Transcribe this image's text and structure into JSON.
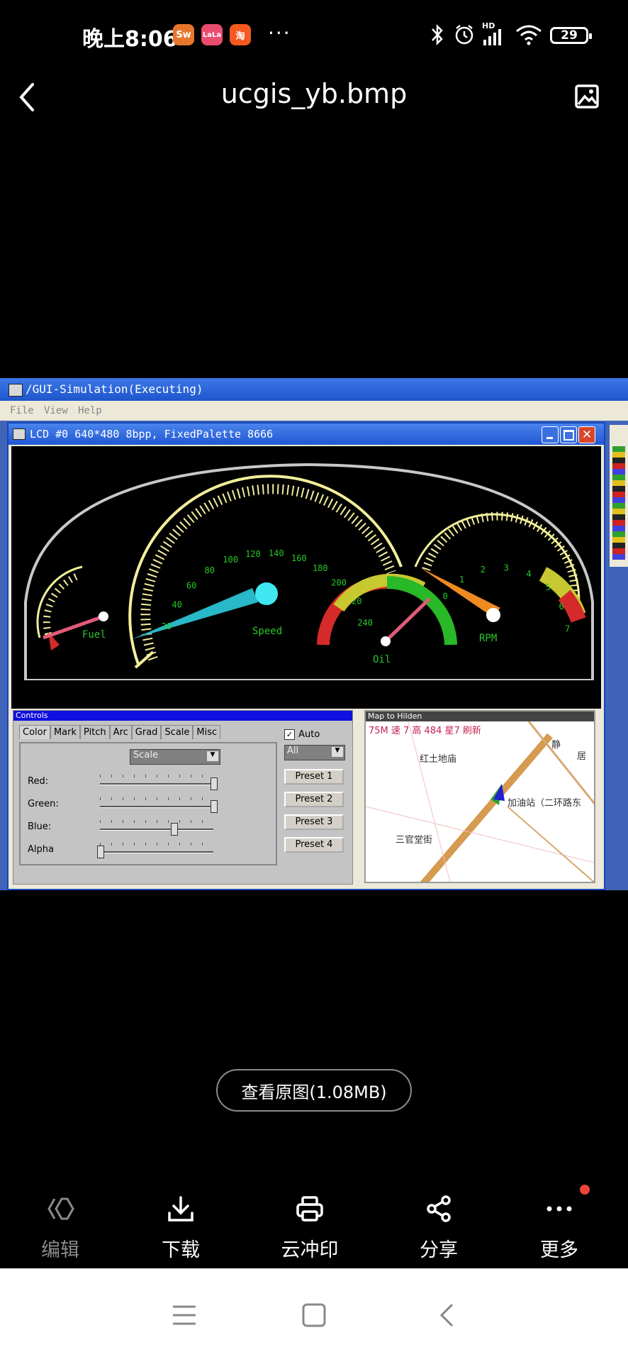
{
  "status_bar": {
    "time": "晚上8:06",
    "apps": [
      {
        "name": "owl-app-icon",
        "label": "Sw",
        "color": "#e8762c"
      },
      {
        "name": "lala-app-icon",
        "label": "LaLa",
        "color": "#ea4c6f"
      },
      {
        "name": "taobao-app-icon",
        "label": "淘",
        "color": "#f35a20"
      }
    ],
    "more": "···",
    "network_label": "HD",
    "battery": "29"
  },
  "header": {
    "title": "ucgis_yb.bmp"
  },
  "screenshot": {
    "outer_title": "/GUI-Simulation(Executing)",
    "menu": [
      "File",
      "View",
      "Help"
    ],
    "lcd_title": "LCD #0 640*480 8bpp, FixedPalette 8666",
    "gauges": {
      "fuel_label": "Fuel",
      "speed_label": "Speed",
      "oil_label": "Oil",
      "rpm_label": "RPM",
      "speed_ticks": [
        "20",
        "40",
        "60",
        "80",
        "100",
        "120",
        "140",
        "160",
        "180",
        "200",
        "220",
        "240"
      ],
      "rpm_ticks": [
        "0",
        "1",
        "2",
        "3",
        "4",
        "5",
        "6",
        "7"
      ]
    },
    "controls": {
      "title": "Controls",
      "tabs": [
        "Color",
        "Mark",
        "Pitch",
        "Arc",
        "Grad",
        "Scale",
        "Misc"
      ],
      "dropdown": "Scale",
      "auto_label": "Auto",
      "all_dropdown": "All",
      "sliders": [
        {
          "label": "Red:",
          "value": 1.0
        },
        {
          "label": "Green:",
          "value": 1.0
        },
        {
          "label": "Blue:",
          "value": 0.65
        },
        {
          "label": "Alpha",
          "value": 0.0
        }
      ],
      "presets": [
        "Preset 1",
        "Preset 2",
        "Preset 3",
        "Preset 4"
      ]
    },
    "map": {
      "title": "Map to Hilden",
      "banner": "75M  速  7  高  484  星7 刷新",
      "labels": [
        "红土地庙",
        "加油站（二环路东",
        "三官堂街",
        "静",
        "居"
      ]
    }
  },
  "view_original": "查看原图(1.08MB)",
  "toolbar": {
    "items": [
      {
        "label": "编辑",
        "icon": "edit-icon",
        "dim": true
      },
      {
        "label": "下载",
        "icon": "download-icon",
        "dim": false
      },
      {
        "label": "云冲印",
        "icon": "print-icon",
        "dim": false
      },
      {
        "label": "分享",
        "icon": "share-icon",
        "dim": false
      },
      {
        "label": "更多",
        "icon": "more-icon",
        "dim": false
      }
    ]
  },
  "colors": {
    "accent_dot": "#f0443a",
    "gauge_yellow": "#f2ef9a",
    "gauge_green": "#28c828",
    "win_blue": "#0a48c8"
  }
}
